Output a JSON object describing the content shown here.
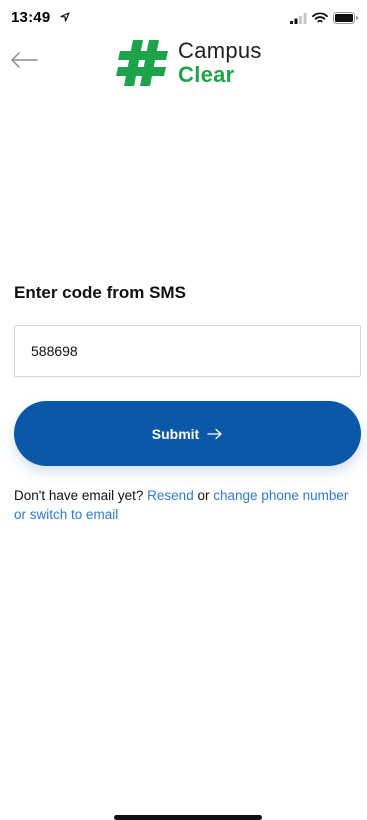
{
  "status_bar": {
    "time": "13:49"
  },
  "header": {
    "logo_line_1": "Campus",
    "logo_line_2": "Clear"
  },
  "form": {
    "heading": "Enter code from SMS",
    "code_value": "588698",
    "submit_label": "Submit",
    "help_prefix": "Don't have email yet?",
    "resend_link": "Resend",
    "help_or": "or",
    "change_link": "change phone number or switch to email"
  },
  "colors": {
    "brand_green": "#1fa34a",
    "button_blue": "#0b57a8",
    "link_blue": "#2f7bd0"
  }
}
